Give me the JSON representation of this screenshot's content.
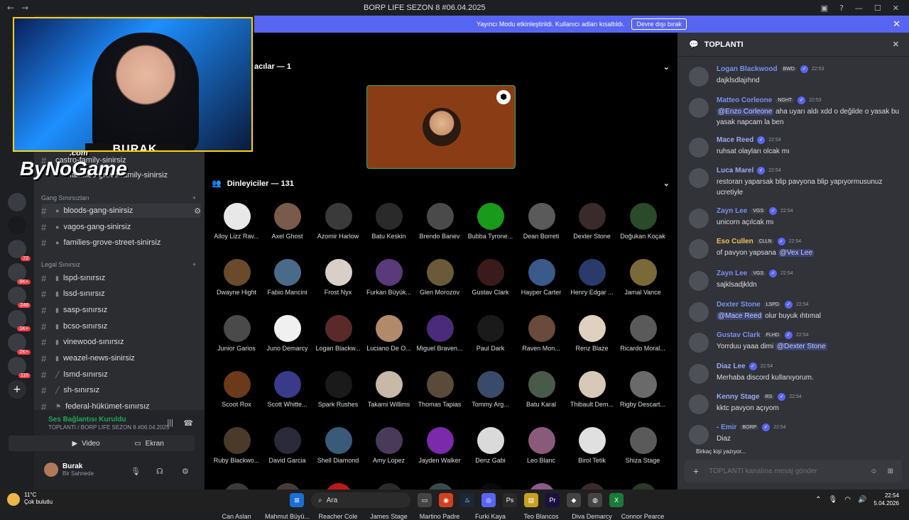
{
  "window": {
    "title": "BORP LIFE SEZON 8 #06.04.2025"
  },
  "banner": {
    "text": "Yayıncı Modu etkinleştirildi. Kullanıcı adları kısaltıldı.",
    "button": "Devre dışı bırak"
  },
  "server_badges": [
    "72",
    "9K+",
    "248",
    "1K+",
    "2K+",
    "116"
  ],
  "webcam": {
    "name_plate": "BURAK"
  },
  "watermark": {
    "line1": "ByNoGame",
    "line2": ".com"
  },
  "channels": {
    "top": [
      "castro-family-sinirsiz",
      "families-grove-family-sinirsiz"
    ],
    "gang_category": "Gang Sınırsızları",
    "gang": [
      "bloods-gang-sinirsiz",
      "vagos-gang-sinirsiz",
      "families-grove-street-sinirsiz"
    ],
    "legal_category": "Legal Sınırsız",
    "legal": [
      "lspd-sınırsız",
      "lssd-sınırsız",
      "sasp-sınırsız",
      "bcso-sınırsız",
      "vinewood-sınırsız",
      "weazel-news-sinirsiz",
      "lsmd-sınırsız",
      "sh-sınırsız",
      "federal-hükümet-sınırsız"
    ]
  },
  "voice": {
    "status": "Ses Bağlantısı Kuruldu",
    "location": "TOPLANTI / BORP LIFE SEZON 8 #06.04.2025",
    "video": "Video",
    "screen": "Ekran"
  },
  "user": {
    "name": "Burak",
    "status": "Bir Sahnede"
  },
  "stage": {
    "speakers_label": "acılar — 1",
    "listeners_label": "Dinleyiciler — 131"
  },
  "listeners": [
    "Alloy Lizz Rav...",
    "Axel Ghost",
    "Azomir Harlow",
    "Batu Keskin",
    "Brendo Banev",
    "Bubba Tyrone...",
    "Dean Borreti",
    "Dexter Stone",
    "Doğukan Koçak",
    "Dwayne Hight",
    "Fabio Mancini",
    "Frost Nyx",
    "Furkan Büyük...",
    "Glen Morozov",
    "Gustav Clark",
    "Hayper Carter",
    "Henry Edgar ...",
    "Jamal Vance",
    "Junior Garios",
    "Juno Demarcy",
    "Logan Blackw...",
    "Luciano De O...",
    "Miguel Braven...",
    "Paul Dark",
    "Raven Mon...",
    "Renz Blaze",
    "Ricardo Moral...",
    "Scoot Rox",
    "Scott Whitte...",
    "Spark Rushes",
    "Takami Willims",
    "Thomas Tapias",
    "Tommy Arg...",
    "Batu Karal",
    "Thibault Dem...",
    "Rigby Descart...",
    "Ruby Blackwo...",
    "David Garcia",
    "Shell Diamond",
    "Amy Lopez",
    "Jayden Walker",
    "Denz Gabi",
    "Leo Blanc",
    "Birol Tetik",
    "Shiza Stage",
    "Can Aslan",
    "Mahmut Büyü...",
    "Reacher Cole",
    "James Stage",
    "Martino Padre",
    "Furki Kaya",
    "Teo Blancos",
    "Diva Demarcy",
    "Connor Pearce"
  ],
  "colors": {
    "listener_avatars": [
      "#e8e8e8",
      "#7a5a4a",
      "#3a3a3a",
      "#2a2a2a",
      "#4a4a4a",
      "#1a9a1a",
      "#5a5a5a",
      "#3a2a2a",
      "#2a4a2a",
      "#6a4a2a",
      "#4a6a8a",
      "#d8d0c8",
      "#5a3a7a",
      "#6a5a3a",
      "#3a1a1a",
      "#3a5a8a",
      "#2a3a6a",
      "#7a6a3a",
      "#4a4a4a",
      "#f0f0f0",
      "#5a2a2a",
      "#b08a6a",
      "#4a2a7a",
      "#1a1a1a",
      "#6a4a3a",
      "#e0d0c0",
      "#5a5a5a",
      "#6a3a1a",
      "#3a3a8a",
      "#1a1a1a",
      "#c8b8a8",
      "#5a4a3a",
      "#3a4a6a",
      "#4a5a4a",
      "#d8c8b8",
      "#6a6a6a",
      "#4a3a2a",
      "#2a2a3a",
      "#3a5a7a",
      "#4a3a5a",
      "#7a2aaa",
      "#dadada",
      "#8a5a7a",
      "#e0e0e0",
      "#5a5a5a",
      "#3a3a3a",
      "#4a3a3a",
      "#c01818",
      "#2a2a2a",
      "#3a4a4a",
      "#0a0a0a",
      "#8a5a8a",
      "#3a2a2a",
      "#2a3a2a"
    ]
  },
  "chat": {
    "title": "TOPLANTI",
    "messages": [
      {
        "author": "Logan Blackwood",
        "tag": "BWD",
        "time": "22:53",
        "text": "dajklsdlajıhnd",
        "color": "#7b8ff0"
      },
      {
        "author": "Matteo Corleone",
        "tag": "NGHT",
        "time": "22:53",
        "mention": "@Enzo Corleone",
        "text": " aha uyarı aldı xdd o değilde o yasak bu yasak napcam la ben",
        "color": "#7b8ff0"
      },
      {
        "author": "Mace Reed",
        "tag": "",
        "time": "22:54",
        "text": "ruhsat olayları olcak mı",
        "color": "#9ca9f5"
      },
      {
        "author": "Luca Marel",
        "tag": "",
        "time": "22:54",
        "text": "restoran yaparsak blip pavyona blip yapıyormusunuz ucretiyle",
        "color": "#9ca9f5"
      },
      {
        "author": "Zayn Lee",
        "tag": "VGS",
        "time": "22:54",
        "text": "unicorn açılcak mı",
        "color": "#7b8ff0"
      },
      {
        "author": "Eso Cullen",
        "tag": "CLLN",
        "time": "22:54",
        "text": "of pavyon yapsana ",
        "mention_end": "@Vex Lee",
        "color": "#f0c060"
      },
      {
        "author": "Zayn Lee",
        "tag": "VGS",
        "time": "22:54",
        "text": "sajklsadjkldn",
        "color": "#7b8ff0"
      },
      {
        "author": "Dexter Stone",
        "tag": "LSPD",
        "time": "22:54",
        "mention": "@Mace Reed",
        "text": " olur buyuk ıhtımal",
        "color": "#7b8ff0"
      },
      {
        "author": "Gustav Clark",
        "tag": "FLHD",
        "time": "22:54",
        "text": "Yorrduu yaaa dimi ",
        "mention_end": "@Dexter Stone",
        "color": "#7b8ff0"
      },
      {
        "author": "Diaz Lee",
        "tag": "",
        "time": "22:54",
        "text": "Merhaba discord kullanıyorum.",
        "color": "#9ca9f5"
      },
      {
        "author": "Kenny Stage",
        "tag": "RS",
        "time": "22:54",
        "text": "kktc pavyon açıyom",
        "color": "#9ca9f5"
      },
      {
        "author": "- Emir",
        "tag": "BORP",
        "time": "22:54",
        "text": "Diaz",
        "color": "#7b8ff0"
      }
    ],
    "typing": "Birkaç kişi yazıyor...",
    "placeholder": "TOPLANTI kanalına mesaj gönder"
  },
  "taskbar": {
    "temp": "11°C",
    "weather": "Çok bulutlu",
    "search": "Ara",
    "time": "22:54",
    "date": "5.04.2026"
  }
}
